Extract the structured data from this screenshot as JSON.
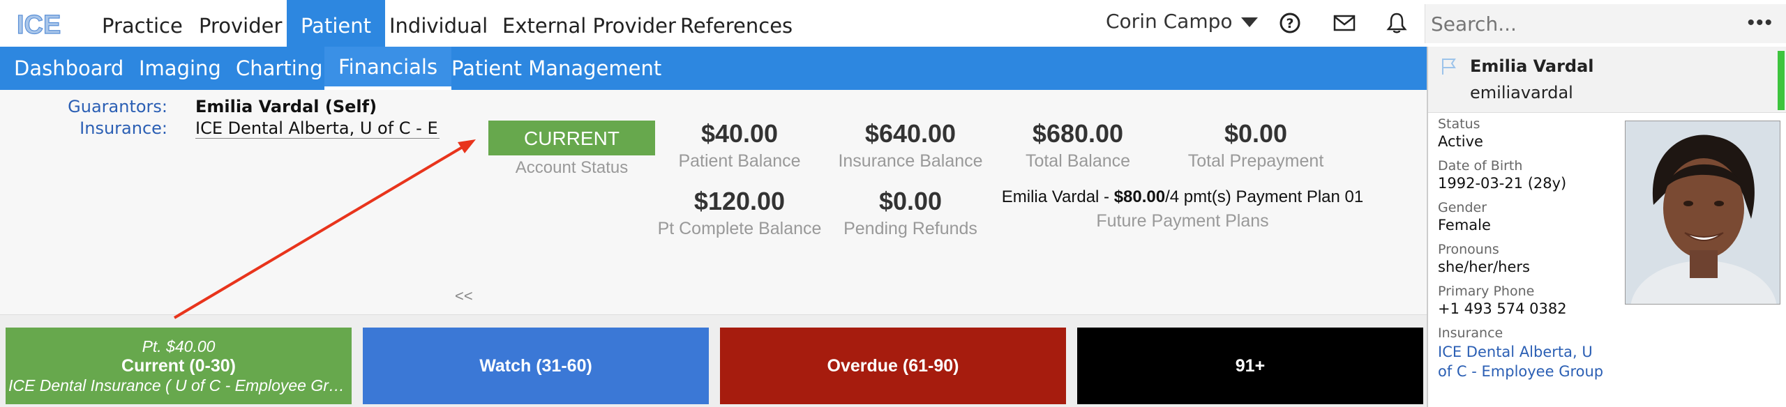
{
  "top_nav": {
    "logo_text": "ICE",
    "items": [
      {
        "label": "Practice"
      },
      {
        "label": "Provider"
      },
      {
        "label": "Patient"
      },
      {
        "label": "Individual"
      },
      {
        "label": "External Provider"
      },
      {
        "label": "References"
      }
    ],
    "active": "Patient",
    "user_name": "Corin Campo",
    "icons": [
      "help-icon",
      "mail-icon",
      "bell-icon"
    ],
    "search_placeholder": "Search...",
    "more_label": "•••"
  },
  "sub_nav": {
    "items": [
      {
        "label": "Dashboard"
      },
      {
        "label": "Imaging"
      },
      {
        "label": "Charting"
      },
      {
        "label": "Financials"
      },
      {
        "label": "Patient Management"
      }
    ],
    "active": "Financials"
  },
  "financials": {
    "guarantors_label": "Guarantors:",
    "guarantors_value": "Emilia Vardal (Self)",
    "insurance_label": "Insurance:",
    "insurance_value": "ICE Dental Alberta, U of C - E...",
    "account_status": "CURRENT",
    "account_status_caption": "Account Status",
    "status_color": "#67a84d",
    "metrics": {
      "patient_balance": {
        "amount": "$40.00",
        "caption": "Patient Balance"
      },
      "insurance_balance": {
        "amount": "$640.00",
        "caption": "Insurance Balance"
      },
      "total_balance": {
        "amount": "$680.00",
        "caption": "Total Balance"
      },
      "total_prepayment": {
        "amount": "$0.00",
        "caption": "Total Prepayment"
      },
      "pt_complete_balance": {
        "amount": "$120.00",
        "caption": "Pt Complete Balance"
      },
      "pending_refunds": {
        "amount": "$0.00",
        "caption": "Pending Refunds"
      }
    },
    "payment_plan": {
      "prefix": "Emilia Vardal - ",
      "amount": "$80.00",
      "suffix": "/4 pmt(s) Payment Plan 01",
      "caption": "Future Payment Plans"
    },
    "collapse_label": "<<"
  },
  "aging_buckets": [
    {
      "sub": "Pt. $40.00",
      "title": "Current (0-30)",
      "sub2": "ICE Dental Insurance ( U of C - Employee Gro...",
      "color": "#67a84d"
    },
    {
      "sub": "",
      "title": "Watch (31-60)",
      "sub2": "",
      "color": "#3b78d6"
    },
    {
      "sub": "",
      "title": "Overdue (61-90)",
      "sub2": "",
      "color": "#a61c0e"
    },
    {
      "sub": "",
      "title": "91+",
      "sub2": "",
      "color": "#000000"
    }
  ],
  "patient_panel": {
    "name": "Emilia Vardal",
    "username": "emiliavardal",
    "fields": {
      "status": {
        "label": "Status",
        "value": "Active"
      },
      "dob": {
        "label": "Date of Birth",
        "value": "1992-03-21 (28y)"
      },
      "gender": {
        "label": "Gender",
        "value": "Female"
      },
      "pronouns": {
        "label": "Pronouns",
        "value": "she/her/hers"
      },
      "phone": {
        "label": "Primary Phone",
        "value": "+1 493 574 0382"
      },
      "insurance": {
        "label": "Insurance",
        "value": "ICE Dental Alberta, U of C - Employee Group"
      }
    }
  },
  "colors": {
    "nav_blue": "#2d87e0",
    "link_blue": "#2b5fb4",
    "arrow_red": "#e8341c",
    "online_green": "#3ec43e"
  }
}
